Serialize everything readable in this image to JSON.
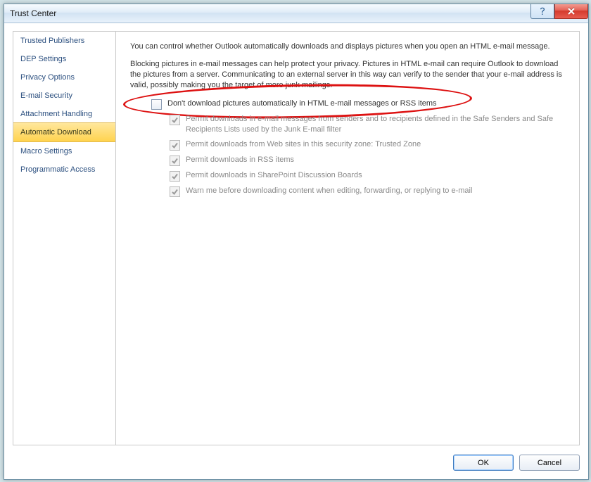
{
  "window": {
    "title": "Trust Center"
  },
  "sidebar": {
    "items": [
      {
        "label": "Trusted Publishers"
      },
      {
        "label": "DEP Settings"
      },
      {
        "label": "Privacy Options"
      },
      {
        "label": "E-mail Security"
      },
      {
        "label": "Attachment Handling"
      },
      {
        "label": "Automatic Download",
        "selected": true
      },
      {
        "label": "Macro Settings"
      },
      {
        "label": "Programmatic Access"
      }
    ]
  },
  "content": {
    "intro": "You can control whether Outlook automatically downloads and displays pictures when you open an HTML e-mail message.",
    "blocking_note": "Blocking pictures in e-mail messages can help protect your privacy. Pictures in HTML e-mail can require Outlook to download the pictures from a server. Communicating to an external server in this way can verify to the sender that your e-mail address is valid, possibly making you the target of more junk mailings.",
    "options": {
      "main": "Don't download pictures automatically in HTML e-mail messages or RSS items",
      "sub1": "Permit downloads in e-mail messages from senders and to recipients defined in the Safe Senders and Safe Recipients Lists used by the Junk E-mail filter",
      "sub2": "Permit downloads from Web sites in this security zone: Trusted Zone",
      "sub3": "Permit downloads in RSS items",
      "sub4": "Permit downloads in SharePoint Discussion Boards",
      "sub5": "Warn me before downloading content when editing, forwarding, or replying to e-mail"
    }
  },
  "buttons": {
    "ok": "OK",
    "cancel": "Cancel"
  }
}
